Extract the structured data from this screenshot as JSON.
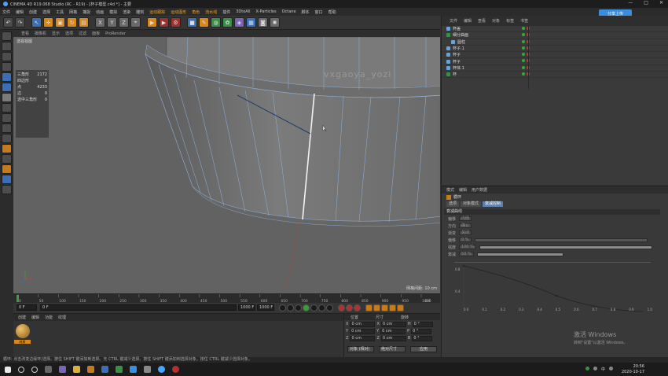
{
  "window": {
    "title": "CINEMA 4D R19.068 Studio (RC - R19) - [杯子模型.c4d *] - 主要",
    "controls": [
      "—",
      "□",
      "✕"
    ]
  },
  "menu": {
    "items": [
      "文件",
      "编辑",
      "创建",
      "选择",
      "工具",
      "网格",
      "捕捉",
      "动画",
      "模拟",
      "渲染",
      "雕刻",
      "运动跟踪",
      "运动图形",
      "角色",
      "流水线",
      "插件",
      "3DtoAll",
      "X-Particles",
      "Octane",
      "脚本",
      "窗口",
      "帮助"
    ],
    "highlighted": [
      "运动跟踪",
      "运动图形",
      "角色",
      "流水线"
    ]
  },
  "share_button": "分享上传",
  "viewport": {
    "menu": [
      "查看",
      "摄像机",
      "显示",
      "选项",
      "过滤",
      "面板",
      "ProRender"
    ],
    "label": "透视视图",
    "stats": [
      {
        "label": "三角形",
        "value": "2172"
      },
      {
        "label": "四边形",
        "value": "8"
      },
      {
        "label": "点",
        "value": "4233"
      },
      {
        "label": "边",
        "value": "0"
      },
      {
        "label": "选中三角形",
        "value": "0"
      }
    ],
    "grid_info": "网格间距: 10 cm",
    "watermark": "vxgaoya_yozi"
  },
  "timeline": {
    "ticks": [
      "0",
      "50",
      "100",
      "150",
      "200",
      "250",
      "300",
      "350",
      "400",
      "450",
      "500",
      "550",
      "600",
      "650",
      "700",
      "750",
      "800",
      "850",
      "900",
      "950",
      "1000"
    ],
    "end_label": "0 F",
    "start_field": "0 F",
    "current_field": "0 F",
    "end_field": "1000 F",
    "end_field2": "1000 F"
  },
  "material_panel": {
    "tabs": [
      "创建",
      "编辑",
      "功能",
      "纹理"
    ],
    "material_name": "材质"
  },
  "coords": {
    "headers": [
      "位置",
      "尺寸",
      "旋转"
    ],
    "rows": [
      {
        "axis": "X",
        "pos": "0 cm",
        "axis2": "X",
        "size": "0 cm",
        "axis3": "H",
        "rot": "0 °"
      },
      {
        "axis": "Y",
        "pos": "0 cm",
        "axis2": "Y",
        "size": "0 cm",
        "axis3": "P",
        "rot": "0 °"
      },
      {
        "axis": "Z",
        "pos": "0 cm",
        "axis2": "Z",
        "size": "0 cm",
        "axis3": "B",
        "rot": "0 °"
      }
    ],
    "mode": "对象 (相对)",
    "size_mode": "绝对尺寸",
    "apply": "应用"
  },
  "status": "循环: 点击改变边缘环/选择。按住 SHIFT 键添加到选择。无 CTRL 键减少选择。按住 SHIFT 键添加到选择对象，按住 CTRL 键减少选择对象。",
  "object_manager": {
    "tabs": [
      "文件",
      "编辑",
      "查看",
      "对象",
      "标签",
      "书签"
    ],
    "objects": [
      "杯盖",
      "细分曲面",
      "圆柱",
      "杯子.1",
      "杯子",
      "杯子",
      "杯体.1",
      "杯"
    ]
  },
  "attribute_manager": {
    "tabs": [
      "模式",
      "编辑",
      "用户数据"
    ],
    "header": "循环",
    "subtabs": [
      "选项",
      "对象模式",
      "衰减控制"
    ],
    "section": "衰减曲线",
    "props": [
      {
        "label": "偏移",
        "value": "内侧"
      },
      {
        "label": "方向",
        "value": "确认"
      },
      {
        "label": "渐变",
        "value": "关闭"
      },
      {
        "label": "偏移",
        "value": "0 %"
      },
      {
        "label": "强度",
        "value": "100 %"
      },
      {
        "label": "衰减",
        "value": "50 %"
      }
    ],
    "graph_y": [
      "0.8",
      "0.4"
    ],
    "graph_x": [
      "0.0",
      "0.1",
      "0.2",
      "0.3",
      "0.4",
      "0.5",
      "0.6",
      "0.7",
      "0.8",
      "0.9",
      "1.0"
    ]
  },
  "win_watermark": {
    "line1": "激活 Windows",
    "line2": "转到\"设置\"以激活 Windows。"
  },
  "tray": {
    "time": "20:56",
    "date": "2020-10-17",
    "lang": "中"
  }
}
